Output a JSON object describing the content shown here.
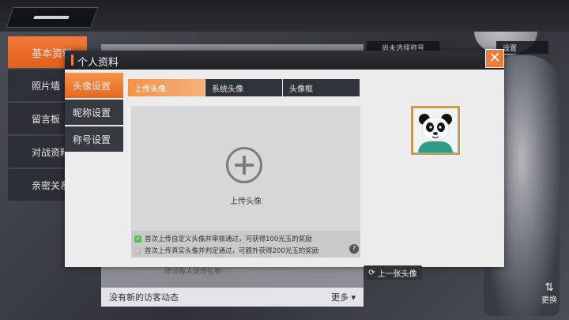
{
  "background": {
    "left_menu": [
      "基本资料",
      "照片墙",
      "留言板",
      "对战资料",
      "亲密关系"
    ],
    "title_box": "尚未选择称号",
    "settings_box": "设置",
    "hint": "还没有人送你礼物",
    "footer_text": "没有新的访客动态",
    "footer_more": "更多",
    "swap_label": "更换"
  },
  "dialog": {
    "title": "个人资料",
    "close_icon": "close-icon",
    "side_tabs": [
      "头像设置",
      "昵称设置",
      "称号设置"
    ],
    "sub_tabs": [
      "上传头像",
      "系统头像",
      "头像框"
    ],
    "upload_label": "上传头像",
    "prev_button": "上一张头像",
    "notices": [
      "首次上传自定义头像并审核通过，可获得100光玉的奖励",
      "首次上传真实头像并判定通过，可额外获得200光玉的奖励"
    ]
  },
  "colors": {
    "accent": "#f07a3a",
    "panel": "#ececec",
    "dark": "#2f343a"
  }
}
